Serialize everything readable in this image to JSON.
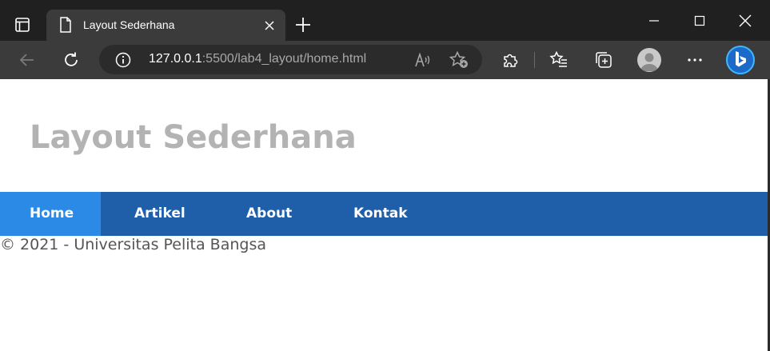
{
  "browser": {
    "tab": {
      "title": "Layout Sederhana"
    },
    "address": {
      "host": "127.0.0.1",
      "rest": ":5500/lab4_layout/home.html"
    },
    "icons": {
      "tab_actions": "tab-actions-icon",
      "page": "page-icon",
      "close_tab": "close-icon",
      "new_tab": "plus-icon",
      "minimize": "minimize-icon",
      "maximize": "maximize-icon",
      "close_window": "close-window-icon",
      "back": "back-arrow-icon",
      "refresh": "refresh-icon",
      "site_info": "info-icon",
      "read_aloud": "read-aloud-icon",
      "add_favorite": "star-plus-icon",
      "extensions": "puzzle-icon",
      "favorites": "favorites-icon",
      "collections": "collections-icon",
      "profile": "avatar",
      "more": "more-icon",
      "bing": "bing-icon"
    },
    "colors": {
      "tabstrip": "#202020",
      "toolbar": "#3b3b3b",
      "omnibox": "#2b2b2b"
    }
  },
  "page": {
    "title": "Layout Sederhana",
    "nav": [
      {
        "label": "Home",
        "active": true
      },
      {
        "label": "Artikel",
        "active": false
      },
      {
        "label": "About",
        "active": false
      },
      {
        "label": "Kontak",
        "active": false
      }
    ],
    "footer": "© 2021 - Universitas Pelita Bangsa",
    "colors": {
      "title": "#b3b3b3",
      "nav_bg": "#1f5faa",
      "nav_active": "#2b8ae5",
      "nav_text": "#ffffff",
      "footer_text": "#555555"
    }
  }
}
